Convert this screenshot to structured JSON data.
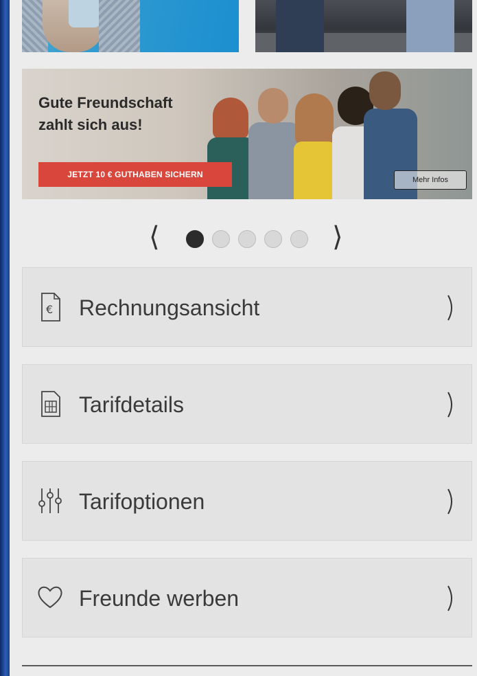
{
  "banner": {
    "title_line1": "Gute Freundschaft",
    "title_line2": "zahlt sich aus!",
    "cta_label": "JETZT 10 € GUTHABEN SICHERN",
    "more_label": "Mehr Infos"
  },
  "carousel": {
    "prev_glyph": "⟨",
    "next_glyph": "⟩",
    "slide_count": 5,
    "active_index": 0
  },
  "menu": {
    "items": [
      {
        "label": "Rechnungsansicht",
        "icon": "invoice-euro-icon"
      },
      {
        "label": "Tarifdetails",
        "icon": "sim-card-icon"
      },
      {
        "label": "Tarifoptionen",
        "icon": "sliders-icon"
      },
      {
        "label": "Freunde werben",
        "icon": "heart-icon"
      }
    ]
  },
  "colors": {
    "cta": "#d9463b",
    "dot_active": "#2b2b2b",
    "dot_inactive": "#d8d8d8",
    "menu_bg": "#e3e3e3"
  }
}
